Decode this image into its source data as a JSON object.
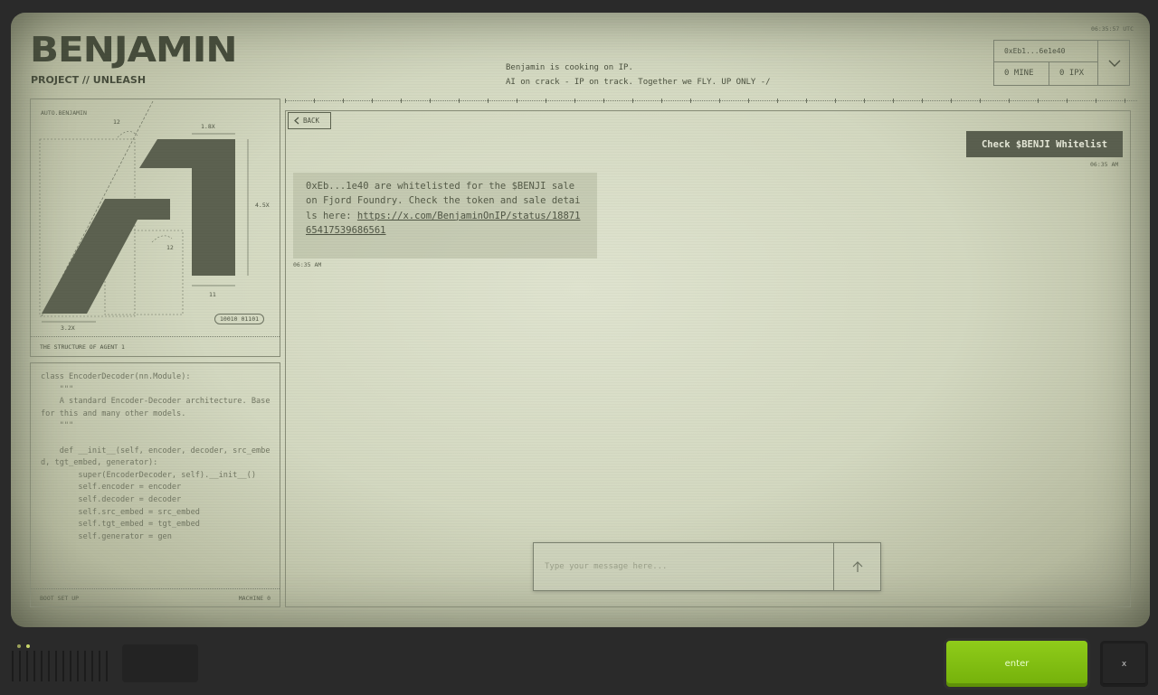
{
  "header": {
    "title": "BENJAMIN",
    "subtitle": "PROJECT // UNLEASH",
    "tagline_line1": "Benjamin is cooking on IP.",
    "tagline_line2": "AI on crack - IP on track. Together we FLY. UP ONLY -/",
    "utc_time": "06:35:57 UTC"
  },
  "wallet": {
    "address": "0xEb1...6e1e40",
    "mine_balance": "0 MINE",
    "ipx_balance": "0 IPX",
    "toggle_icon": "chevron-down-icon"
  },
  "diagram": {
    "id_label": "AUTO.BENJAMIN",
    "dim_top": "1.8X",
    "dim_right": "4.5X",
    "dim_left": "12",
    "dim_mid": "12",
    "dim_bottom_right": "11",
    "dim_bottom_left": "3.2X",
    "code_tag": "10010 01101",
    "caption": "THE STRUCTURE OF AGENT 1"
  },
  "code_panel": {
    "code": "class EncoderDecoder(nn.Module):\n    \"\"\"\n    A standard Encoder-Decoder architecture. Base for this and many other models.\n    \"\"\"\n\n    def __init__(self, encoder, decoder, src_embed, tgt_embed, generator):\n        super(EncoderDecoder, self).__init__()\n        self.encoder = encoder\n        self.decoder = decoder\n        self.src_embed = src_embed\n        self.tgt_embed = tgt_embed\n        self.generator = gen",
    "footer_left": "BOOT SET UP",
    "footer_right": "MACHINE 0"
  },
  "chat": {
    "back_label": "BACK",
    "check_button_label": "Check $BENJI Whitelist",
    "check_time": "06:35 AM",
    "message_text": "0xEb...1e40 are whitelisted for the $BENJI sale on Fjord Foundry. Check the token and sale details here:",
    "message_link": "https://x.com/BenjaminOnIP/status/1887165417539686561",
    "message_time": "06:35 AM",
    "input_placeholder": "Type your message here...",
    "send_icon": "arrow-up-icon"
  },
  "hardware": {
    "enter_label": "enter",
    "close_label": "x",
    "led_colors": [
      "#9aa05a",
      "#c8d66a"
    ]
  }
}
